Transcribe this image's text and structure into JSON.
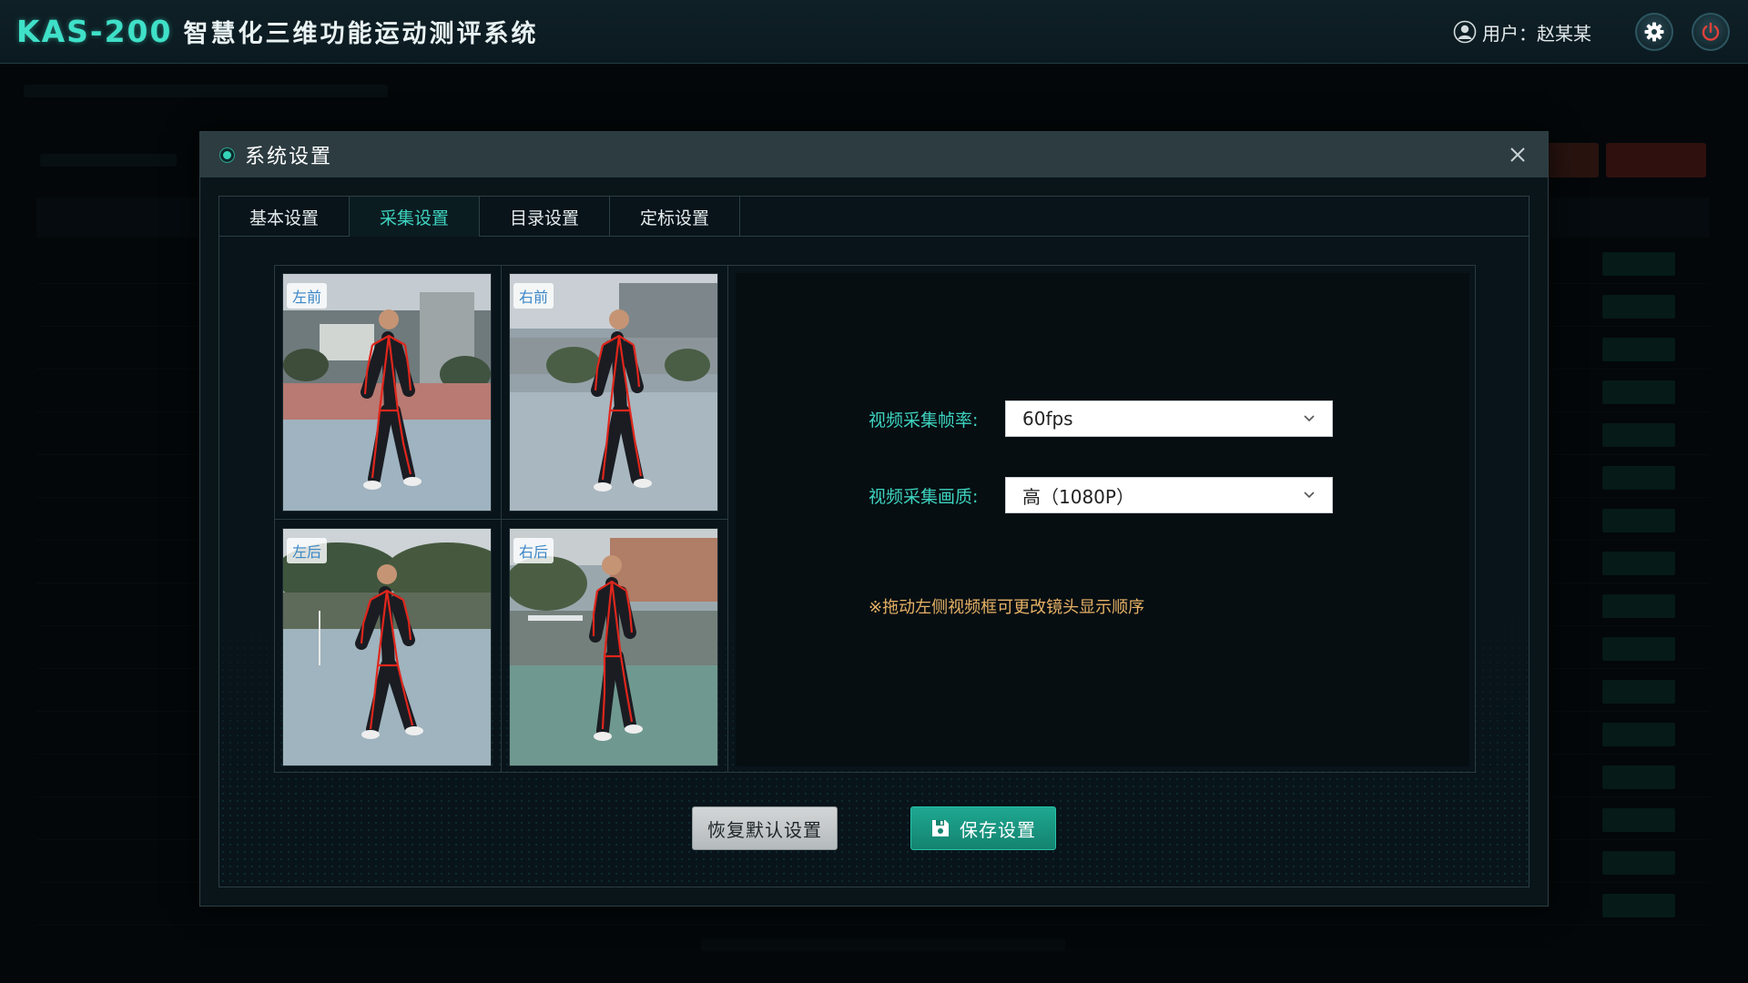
{
  "app": {
    "logo_text": "KAS-200",
    "title": "智慧化三维功能运动测评系统",
    "user_label": "用户：赵某某",
    "accent_color": "#3ed3bf",
    "icons": {
      "user": "user-icon",
      "settings": "gear-icon",
      "power": "power-icon"
    }
  },
  "dialog": {
    "title": "系统设置",
    "tabs": [
      {
        "label": "基本设置",
        "active": false
      },
      {
        "label": "采集设置",
        "active": true
      },
      {
        "label": "目录设置",
        "active": false
      },
      {
        "label": "定标设置",
        "active": false
      }
    ],
    "cameras": [
      {
        "label": "左前"
      },
      {
        "label": "右前"
      },
      {
        "label": "左后"
      },
      {
        "label": "右后"
      }
    ],
    "frame_rate": {
      "label": "视频采集帧率:",
      "value": "60fps"
    },
    "quality": {
      "label": "视频采集画质:",
      "value": "高（1080P）"
    },
    "hint": "※拖动左侧视频框可更改镜头显示顺序",
    "buttons": {
      "reset": "恢复默认设置",
      "save": "保存设置"
    },
    "colors": {
      "hint": "#e8b266",
      "save_button": "#1ea892",
      "skeleton": "#e0261c"
    }
  }
}
